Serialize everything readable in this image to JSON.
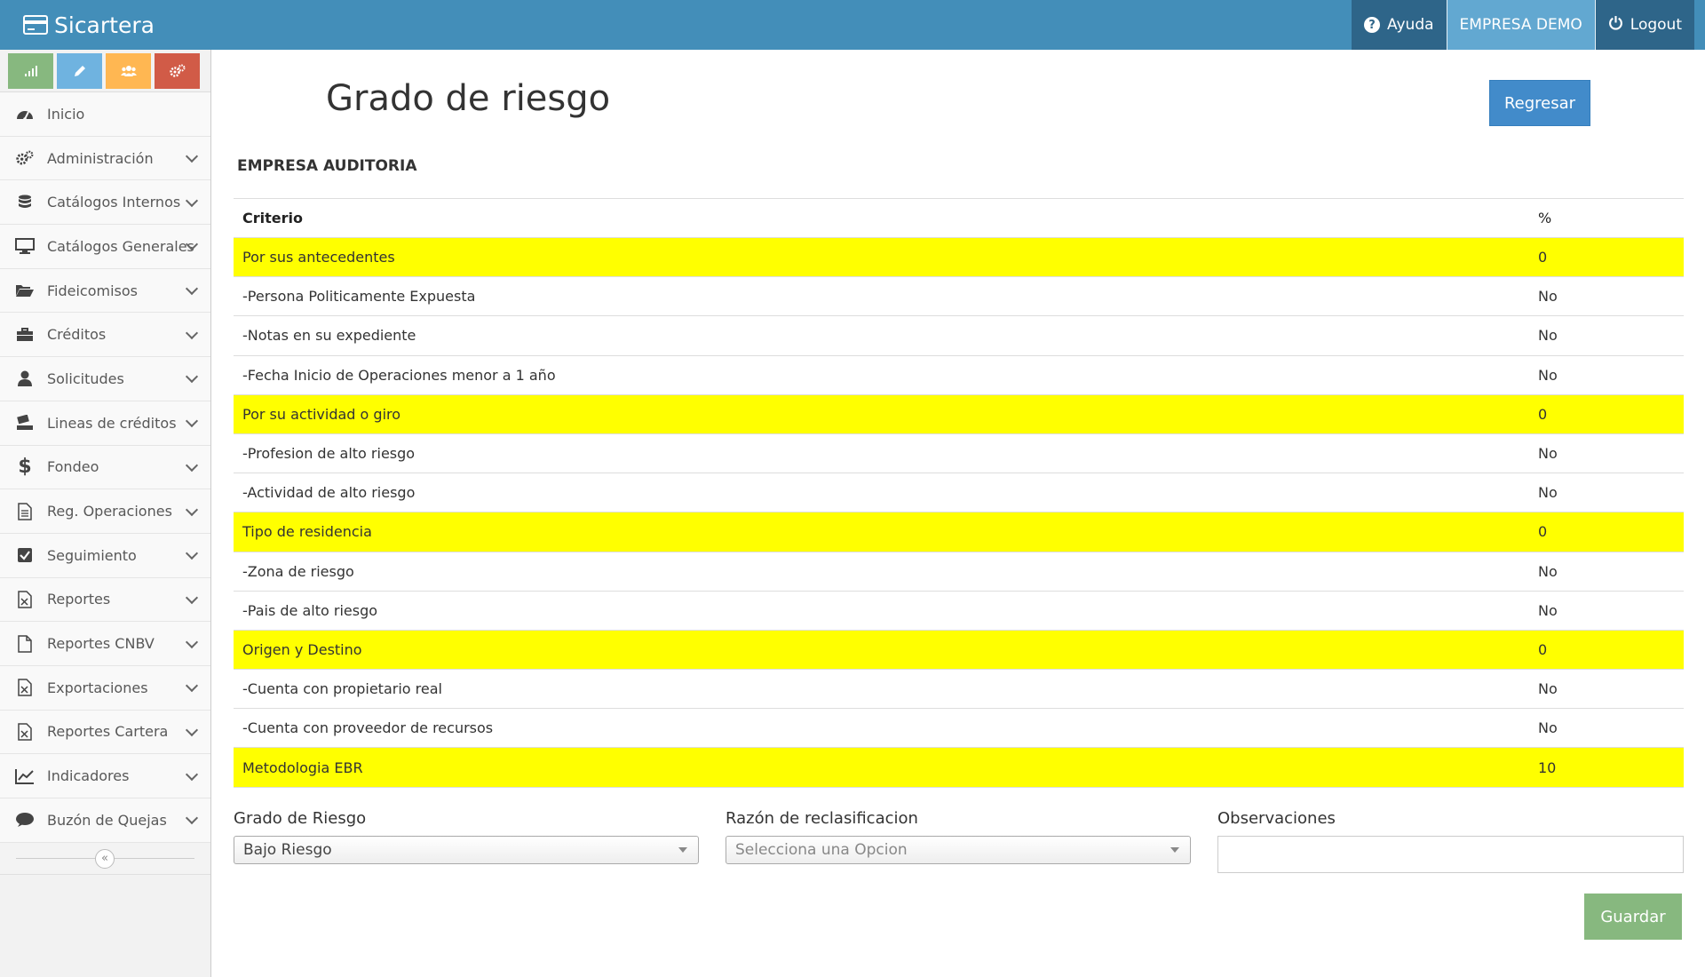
{
  "navbar": {
    "brand": "Sicartera",
    "help_label": "Ayuda",
    "company_label": "EMPRESA DEMO",
    "logout_label": "Logout",
    "colors": {
      "primary": "#438eb9",
      "dark": "#2e6589",
      "light": "#62a8d1"
    }
  },
  "sidebar": {
    "shortcuts": [
      {
        "icon": "signal-icon",
        "color": "#87b87f"
      },
      {
        "icon": "pencil-icon",
        "color": "#6fb3e0"
      },
      {
        "icon": "users-icon",
        "color": "#ffb752"
      },
      {
        "icon": "cogs-icon",
        "color": "#d15b47"
      }
    ],
    "items": [
      {
        "label": "Inicio",
        "icon": "dashboard-icon"
      },
      {
        "label": "Administración",
        "icon": "cogs-icon"
      },
      {
        "label": "Catálogos Internos",
        "icon": "database-icon"
      },
      {
        "label": "Catálogos Generales",
        "icon": "desktop-icon"
      },
      {
        "label": "Fideicomisos",
        "icon": "folder-open-icon"
      },
      {
        "label": "Créditos",
        "icon": "briefcase-icon"
      },
      {
        "label": "Solicitudes",
        "icon": "user-icon"
      },
      {
        "label": "Lineas de créditos",
        "icon": "inbox-icon"
      },
      {
        "label": "Fondeo",
        "icon": "dollar-icon"
      },
      {
        "label": "Reg. Operaciones",
        "icon": "file-text-icon"
      },
      {
        "label": "Seguimiento",
        "icon": "check-square-icon"
      },
      {
        "label": "Reportes",
        "icon": "file-excel-icon"
      },
      {
        "label": "Reportes CNBV",
        "icon": "file-icon"
      },
      {
        "label": "Exportaciones",
        "icon": "file-excel-icon"
      },
      {
        "label": "Reportes Cartera",
        "icon": "file-excel-icon"
      },
      {
        "label": "Indicadores",
        "icon": "line-chart-icon"
      },
      {
        "label": "Buzón de Quejas",
        "icon": "comment-icon"
      }
    ]
  },
  "main": {
    "title": "Grado de riesgo",
    "back_label": "Regresar",
    "company": "EMPRESA AUDITORIA",
    "table": {
      "headers": {
        "criterion": "Criterio",
        "percent": "%"
      },
      "rows": [
        {
          "criterion": "Por sus antecedentes",
          "value": "0",
          "highlight": true
        },
        {
          "criterion": "-Persona Politicamente Expuesta",
          "value": "No",
          "highlight": false
        },
        {
          "criterion": "-Notas en su expediente",
          "value": "No",
          "highlight": false
        },
        {
          "criterion": "-Fecha Inicio de Operaciones menor a 1 año",
          "value": "No",
          "highlight": false
        },
        {
          "criterion": "Por su actividad o giro",
          "value": "0",
          "highlight": true
        },
        {
          "criterion": "-Profesion de alto riesgo",
          "value": "No",
          "highlight": false
        },
        {
          "criterion": "-Actividad de alto riesgo",
          "value": "No",
          "highlight": false
        },
        {
          "criterion": "Tipo de residencia",
          "value": "0",
          "highlight": true
        },
        {
          "criterion": "-Zona de riesgo",
          "value": "No",
          "highlight": false
        },
        {
          "criterion": "-Pais de alto riesgo",
          "value": "No",
          "highlight": false
        },
        {
          "criterion": "Origen y Destino",
          "value": "0",
          "highlight": true
        },
        {
          "criterion": "-Cuenta con propietario real",
          "value": "No",
          "highlight": false
        },
        {
          "criterion": "-Cuenta con proveedor de recursos",
          "value": "No",
          "highlight": false
        },
        {
          "criterion": "Metodologia EBR",
          "value": "10",
          "highlight": true
        }
      ],
      "highlight_color": "#ffff00"
    },
    "form": {
      "risk_label": "Grado de Riesgo",
      "risk_value": "Bajo Riesgo",
      "reason_label": "Razón de reclasificacion",
      "reason_placeholder": "Selecciona una Opcion",
      "notes_label": "Observaciones",
      "notes_value": "",
      "save_label": "Guardar"
    }
  }
}
